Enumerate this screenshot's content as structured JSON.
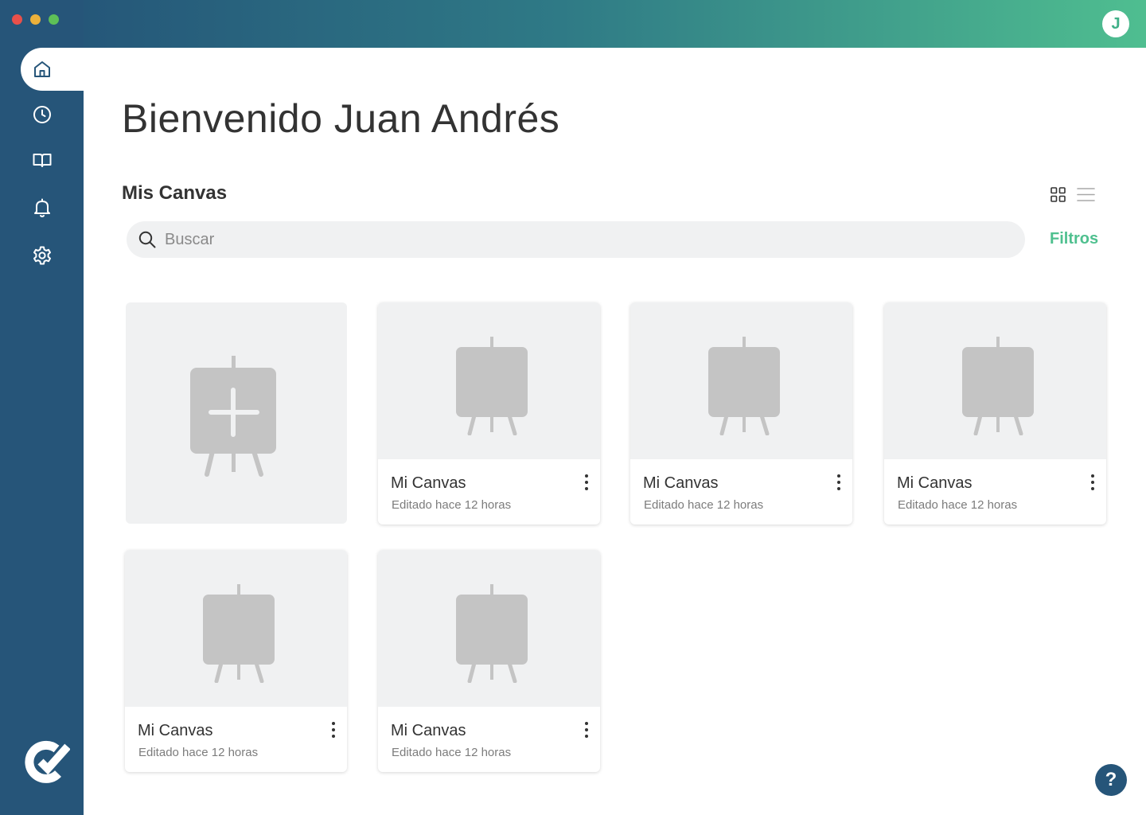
{
  "window": {
    "controls": [
      "close",
      "minimize",
      "zoom"
    ]
  },
  "user": {
    "initial": "J"
  },
  "sidebar": {
    "items": [
      {
        "icon": "home-icon",
        "active": true
      },
      {
        "icon": "clock-icon",
        "active": false
      },
      {
        "icon": "book-icon",
        "active": false
      },
      {
        "icon": "bell-icon",
        "active": false
      },
      {
        "icon": "gear-icon",
        "active": false
      }
    ],
    "logo": "brand-logo"
  },
  "main": {
    "title": "Bienvenido Juan Andrés",
    "section_title": "Mis Canvas",
    "view_modes": [
      "grid",
      "list"
    ],
    "active_view": "grid",
    "search": {
      "placeholder": "Buscar",
      "value": ""
    },
    "filters_label": "Filtros",
    "new_canvas": {
      "icon": "add-canvas-icon"
    },
    "canvases": [
      {
        "name": "Mi Canvas",
        "edited": "Editado hace 12 horas"
      },
      {
        "name": "Mi Canvas",
        "edited": "Editado hace 12 horas"
      },
      {
        "name": "Mi Canvas",
        "edited": "Editado hace 12 horas"
      },
      {
        "name": "Mi Canvas",
        "edited": "Editado hace 12 horas"
      },
      {
        "name": "Mi Canvas",
        "edited": "Editado hace 12 horas"
      }
    ]
  },
  "help": {
    "label": "?"
  },
  "colors": {
    "sidebar": "#265579",
    "accent": "#4fc08f",
    "gradient_start": "#255779",
    "gradient_end": "#4fbe90"
  }
}
